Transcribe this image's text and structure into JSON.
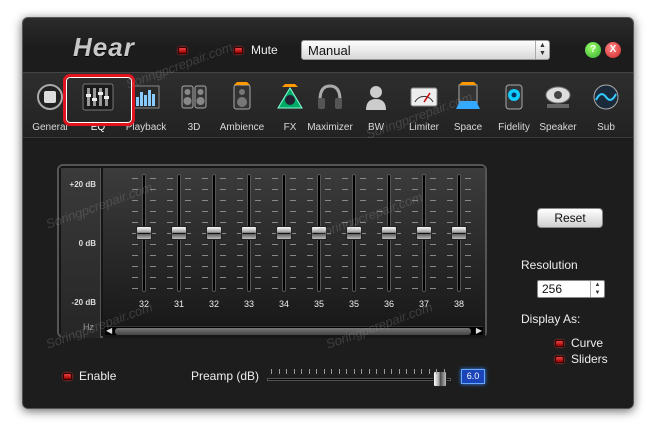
{
  "app": {
    "logo": "Hear"
  },
  "header": {
    "mute_label": "Mute",
    "preset_value": "Manual",
    "help_glyph": "?",
    "close_glyph": "X"
  },
  "tabs": [
    {
      "label": "General",
      "icon": "general-icon"
    },
    {
      "label": "EQ",
      "icon": "eq-icon",
      "active": true
    },
    {
      "label": "Playback",
      "icon": "playback-icon"
    },
    {
      "label": "3D",
      "icon": "speakers-3d-icon"
    },
    {
      "label": "Ambience",
      "icon": "ambience-icon"
    },
    {
      "label": "FX",
      "icon": "fx-icon"
    },
    {
      "label": "Maximizer",
      "icon": "headphones-icon"
    },
    {
      "label": "BW",
      "icon": "brainwave-icon"
    },
    {
      "label": "Limiter",
      "icon": "limiter-gauge-icon"
    },
    {
      "label": "Space",
      "icon": "space-icon"
    },
    {
      "label": "Fidelity",
      "icon": "fidelity-icon"
    },
    {
      "label": "Speaker",
      "icon": "speaker-icon"
    },
    {
      "label": "Sub",
      "icon": "subwoofer-icon"
    }
  ],
  "eq": {
    "db_top": "+20 dB",
    "db_mid": "0 dB",
    "db_bottom": "-20 dB",
    "hz_label": "Hz",
    "bands": [
      {
        "freq": "32",
        "gain_db": 0
      },
      {
        "freq": "31",
        "gain_db": 0
      },
      {
        "freq": "32",
        "gain_db": 0
      },
      {
        "freq": "33",
        "gain_db": 0
      },
      {
        "freq": "34",
        "gain_db": 0
      },
      {
        "freq": "35",
        "gain_db": 0
      },
      {
        "freq": "35",
        "gain_db": 0
      },
      {
        "freq": "36",
        "gain_db": 0
      },
      {
        "freq": "37",
        "gain_db": 0
      },
      {
        "freq": "38",
        "gain_db": 0
      }
    ]
  },
  "controls": {
    "reset_label": "Reset",
    "resolution_label": "Resolution",
    "resolution_value": "256",
    "display_as_label": "Display As:",
    "curve_label": "Curve",
    "sliders_label": "Sliders",
    "enable_label": "Enable",
    "preamp_label": "Preamp (dB)",
    "preamp_value": "6.0"
  },
  "watermark_text": "Soringpcrepair.com",
  "colors": {
    "highlight": "#e0141e",
    "led": "#cc2222",
    "preamp_display": "#1a44b8"
  }
}
